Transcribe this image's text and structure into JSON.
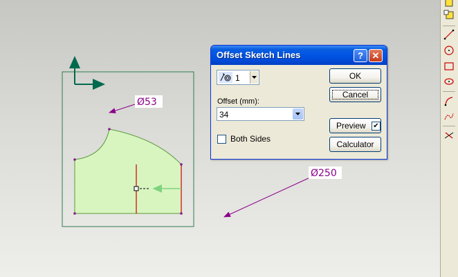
{
  "dialog": {
    "title": "Offset Sketch Lines",
    "count_value": "1",
    "offset_label": "Offset (mm):",
    "offset_value": "34",
    "both_sides_label": "Both Sides",
    "both_sides_checked": false,
    "ok_label": "OK",
    "cancel_label": "Cancel",
    "preview_label": "Preview",
    "preview_checked": true,
    "calculator_label": "Calculator",
    "help_glyph": "?",
    "close_glyph": "✕"
  },
  "sketch": {
    "dimension_small": "Ø53",
    "dimension_large": "Ø250"
  },
  "toolbar": {
    "tools": [
      "cube-icon",
      "table-icon",
      "line-icon",
      "circle-icon",
      "rectangle-icon",
      "ellipse-icon",
      "arc-icon",
      "spline-icon",
      "trim-icon"
    ]
  },
  "colors": {
    "dimension": "#8b008b",
    "profile_fill": "#d8f5c0",
    "profile_edge": "#5a9a3a",
    "axis": "#006a4e",
    "offset_line": "#cc0000",
    "frame": "#2e7d4f"
  }
}
